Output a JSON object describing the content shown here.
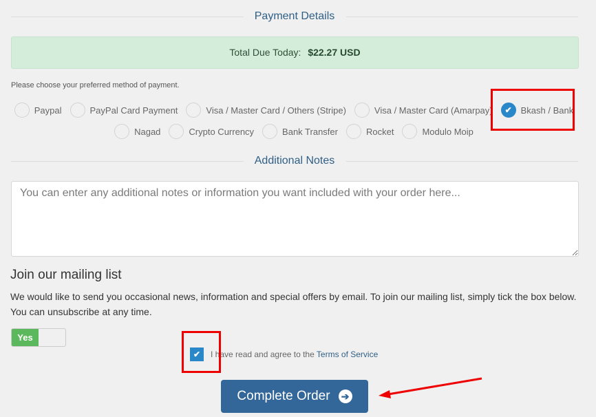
{
  "payment_details": {
    "heading": "Payment Details",
    "total_due_label": "Total Due Today:",
    "total_due_amount": "$22.27 USD",
    "choose_text": "Please choose your preferred method of payment.",
    "methods_row1": [
      {
        "label": "Paypal",
        "checked": false
      },
      {
        "label": "PayPal Card Payment",
        "checked": false
      },
      {
        "label": "Visa / Master Card / Others (Stripe)",
        "checked": false
      },
      {
        "label": "Visa / Master Card (Amarpay)",
        "checked": false
      },
      {
        "label": "Bkash / Bank",
        "checked": true
      }
    ],
    "methods_row2": [
      {
        "label": "Nagad",
        "checked": false
      },
      {
        "label": "Crypto Currency",
        "checked": false
      },
      {
        "label": "Bank Transfer",
        "checked": false
      },
      {
        "label": "Rocket",
        "checked": false
      },
      {
        "label": "Modulo Moip",
        "checked": false
      }
    ],
    "selected_method": "Bkash / Bank"
  },
  "additional_notes": {
    "heading": "Additional Notes",
    "placeholder": "You can enter any additional notes or information you want included with your order here...",
    "value": ""
  },
  "mailing_list": {
    "title": "Join our mailing list",
    "description": "We would like to send you occasional news, information and special offers by email. To join our mailing list, simply tick the box below. You can unsubscribe at any time.",
    "toggle_label": "Yes",
    "toggle_on": true
  },
  "tos": {
    "text": "I have read and agree to the",
    "link_text": "Terms of Service",
    "checked": true
  },
  "complete_order": {
    "label": "Complete Order",
    "icon": "arrow-circle-right-icon"
  },
  "colors": {
    "accent": "#336699",
    "heading": "#2f5f86",
    "checked": "#2a87c8",
    "success_bg": "#d4ecda",
    "toggle_on": "#5cb85c",
    "annotation": "#ee0000"
  }
}
